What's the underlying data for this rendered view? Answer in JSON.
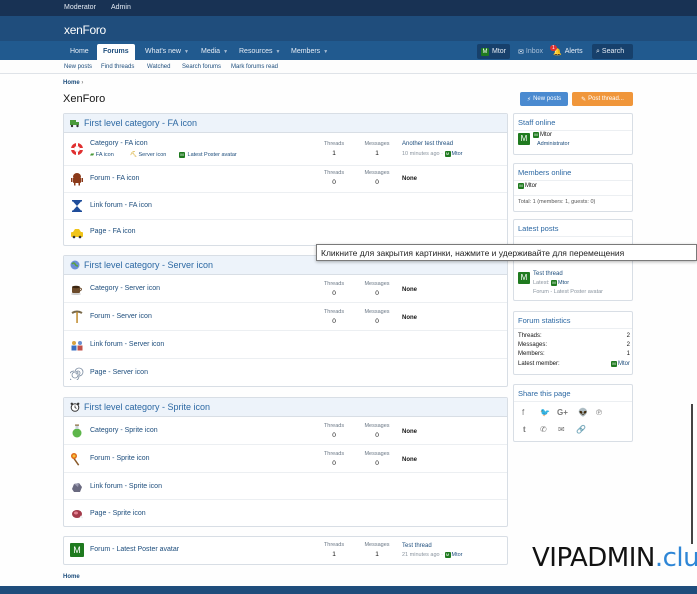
{
  "topbar": {
    "moderator": "Moderator",
    "admin": "Admin"
  },
  "logo": "xenForo",
  "nav": {
    "home": "Home",
    "forums": "Forums",
    "whats_new": "What's new",
    "media": "Media",
    "resources": "Resources",
    "members": "Members",
    "caret": "▼",
    "user": "Mtor",
    "inbox": "Inbox",
    "alerts": "Alerts",
    "alerts_count": "1",
    "search": "Search"
  },
  "subnav": {
    "new_posts": "New posts",
    "find_threads": "Find threads",
    "watched": "Watched",
    "search_forums": "Search forums",
    "mark_read": "Mark forums read"
  },
  "breadcrumb": {
    "home": "Home",
    "sep": "›"
  },
  "page_title": "XenForo",
  "buttons": {
    "new_posts": "New posts",
    "post_thread": "Post thread..."
  },
  "labels": {
    "threads": "Threads",
    "messages": "Messages",
    "none": "None"
  },
  "categories": [
    {
      "title": "First level category - FA icon",
      "rows": [
        {
          "title": "Category - FA icon",
          "threads": "1",
          "messages": "1",
          "last_title": "Another test thread",
          "last_meta": "10 minutes ago · ",
          "last_user": "Mtor",
          "subs": [
            "FA icon",
            "Server icon",
            "Latest Poster avatar"
          ]
        },
        {
          "title": "Forum - FA icon",
          "threads": "0",
          "messages": "0",
          "none": true
        },
        {
          "title": "Link forum - FA icon"
        },
        {
          "title": "Page - FA icon"
        }
      ]
    },
    {
      "title": "First level category - Server icon",
      "rows": [
        {
          "title": "Category - Server icon",
          "threads": "0",
          "messages": "0",
          "none": true
        },
        {
          "title": "Forum - Server icon",
          "threads": "0",
          "messages": "0",
          "none": true
        },
        {
          "title": "Link forum - Server icon"
        },
        {
          "title": "Page - Server icon"
        }
      ]
    },
    {
      "title": "First level category - Sprite icon",
      "rows": [
        {
          "title": "Category - Sprite icon",
          "threads": "0",
          "messages": "0",
          "none": true
        },
        {
          "title": "Forum - Sprite icon",
          "threads": "0",
          "messages": "0",
          "none": true
        },
        {
          "title": "Link forum - Sprite icon"
        },
        {
          "title": "Page - Sprite icon"
        }
      ]
    }
  ],
  "avatar_forum": {
    "title": "Forum - Latest Poster avatar",
    "threads": "1",
    "messages": "1",
    "last_title": "Test thread",
    "last_meta": "21 minutes ago · ",
    "last_user": "Mtor"
  },
  "sidebar": {
    "staff": {
      "title": "Staff online",
      "name": "Mtor",
      "role": "Administrator"
    },
    "members": {
      "title": "Members online",
      "name": "Mtor",
      "total": "Total: 1 (members: 1, guests: 0)"
    },
    "latest": {
      "title": "Latest posts",
      "thread": "Test thread",
      "meta": "Latest: ",
      "user": "Mtor",
      "forum": "Forum - Latest Poster avatar"
    },
    "stats": {
      "title": "Forum statistics",
      "threads_l": "Threads:",
      "threads_v": "2",
      "messages_l": "Messages:",
      "messages_v": "2",
      "members_l": "Members:",
      "members_v": "1",
      "latest_l": "Latest member:",
      "latest_v": "Mtor"
    },
    "share": {
      "title": "Share this page"
    }
  },
  "avatar_letter": "M",
  "tooltip": "Кликните для закрытия картинки, нажмите и удерживайте для перемещения",
  "watermark": {
    "a": "VIPADMIN",
    "b": ".club"
  },
  "footer_crumb": "Home",
  "colors": {
    "brand_dark": "#183254",
    "brand": "#1f4d7c",
    "nav": "#215a8f",
    "link": "#1d4d7c",
    "btn_blue": "#4a8ad0",
    "btn_orange": "#f0963a"
  }
}
